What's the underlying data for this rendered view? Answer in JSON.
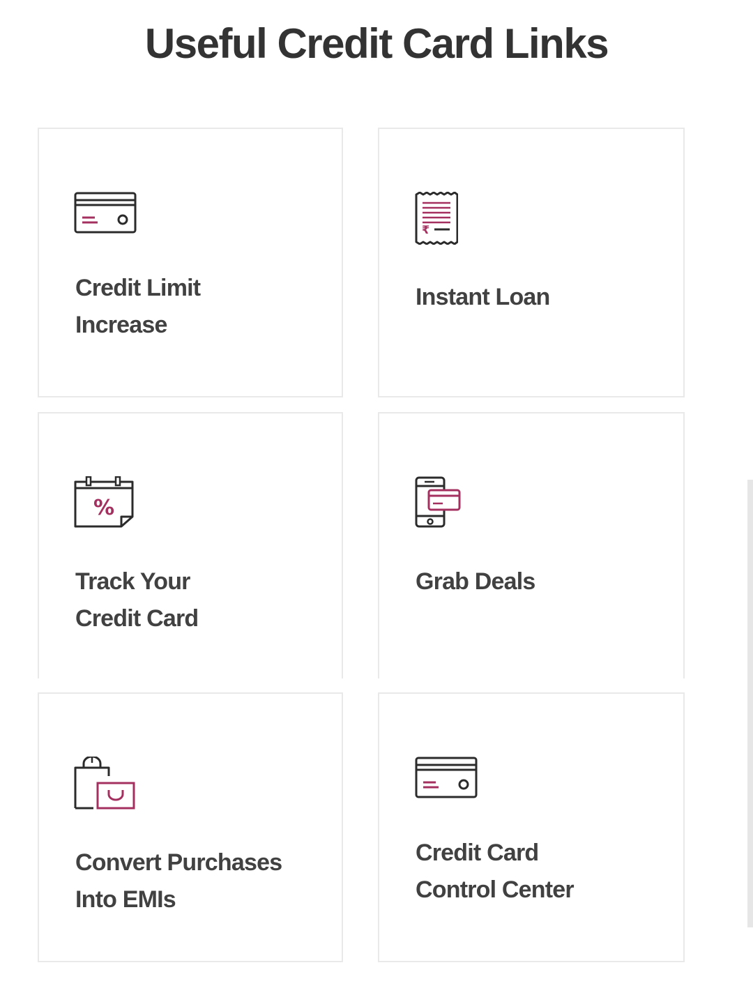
{
  "page": {
    "title": "Useful Credit Card Links"
  },
  "colors": {
    "accent": "#a3305f",
    "icon_outline": "#2b2b2b",
    "text": "#414141",
    "card_border": "#e9e9e9"
  },
  "cards": [
    {
      "id": "credit-limit-increase",
      "icon": "credit-card-icon",
      "line1": "Credit Limit",
      "line2": "Increase"
    },
    {
      "id": "instant-loan",
      "icon": "rupee-receipt-icon",
      "line1": "Instant Loan",
      "line2": ""
    },
    {
      "id": "track-your-credit-card",
      "icon": "calendar-percent-icon",
      "line1": "Track Your",
      "line2": "Credit Card"
    },
    {
      "id": "grab-deals",
      "icon": "mobile-card-icon",
      "line1": "Grab Deals",
      "line2": ""
    },
    {
      "id": "convert-purchases-into-emis",
      "icon": "shopping-bags-icon",
      "line1": "Convert Purchases",
      "line2": "Into EMIs"
    },
    {
      "id": "credit-card-control-center",
      "icon": "credit-card-icon",
      "line1": "Credit Card",
      "line2": "Control Center"
    }
  ]
}
